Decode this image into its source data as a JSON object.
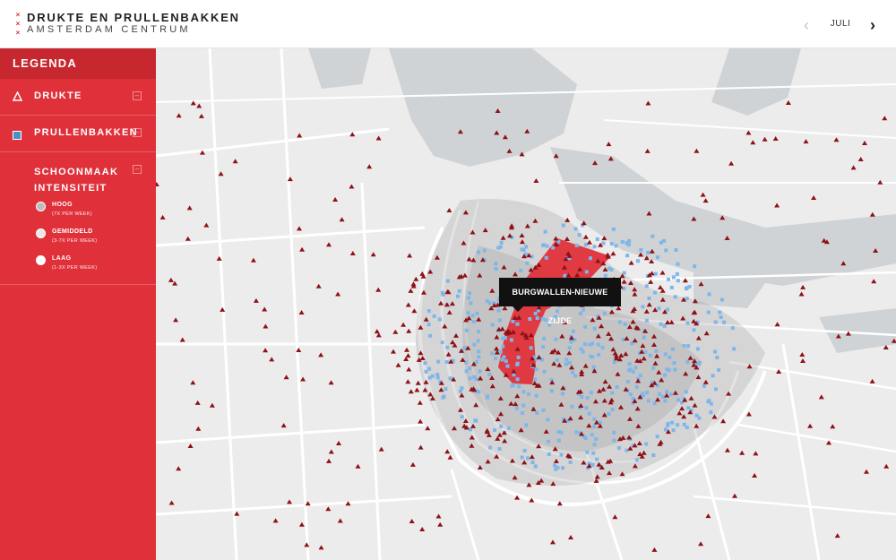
{
  "header": {
    "title": "DRUKTE EN PRULLENBAKKEN",
    "subtitle": "AMSTERDAM CENTRUM",
    "month": "JULI",
    "logo_marks": [
      "×",
      "×",
      "×"
    ]
  },
  "legend": {
    "title": "LEGENDA",
    "items": [
      {
        "label": "DRUKTE",
        "icon": "triangle-outline-icon"
      },
      {
        "label": "PRULLENBAKKEN",
        "icon": "blue-square-icon"
      }
    ],
    "intensity": {
      "label_line1": "SCHOONMAAK",
      "label_line2": "INTENSITEIT",
      "options": [
        {
          "name": "HOOG",
          "freq": "(7X PER WEEK)",
          "selected": true
        },
        {
          "name": "GEMIDDELD",
          "freq": "(3-7X PER WEEK)",
          "selected": false
        },
        {
          "name": "LAAG",
          "freq": "(1-3X PER WEEK)",
          "selected": false
        }
      ]
    },
    "toggle_symbol": "–"
  },
  "map": {
    "highlighted_area": "BURGWALLEN-NIEUWE ZIJDE",
    "colors": {
      "accent": "#e0313b",
      "crowd_marker": "#8e1118",
      "bin_marker": "#7fb6ea",
      "water": "#cfd3d6",
      "land": "#ececec",
      "roads": "#ffffff"
    }
  }
}
